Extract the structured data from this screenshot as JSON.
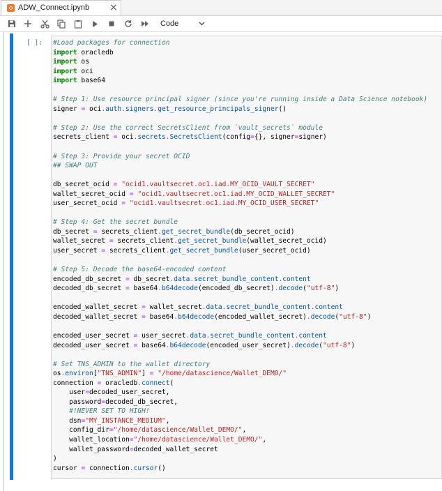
{
  "tab": {
    "title": "ADW_Connect.ipynb",
    "close_label": "×"
  },
  "toolbar": {
    "cell_type": "Code",
    "buttons": [
      "save-icon",
      "add-icon",
      "cut-icon",
      "copy-icon",
      "paste-icon",
      "run-icon",
      "stop-icon",
      "restart-icon",
      "fast-forward-icon"
    ]
  },
  "cell": {
    "prompt": "[ ]:",
    "lines": [
      [
        {
          "t": "cm",
          "v": "#Load packages for connection"
        }
      ],
      [
        {
          "t": "kw",
          "v": "import"
        },
        {
          "t": "var",
          "v": " oracledb"
        }
      ],
      [
        {
          "t": "kw",
          "v": "import"
        },
        {
          "t": "var",
          "v": " os"
        }
      ],
      [
        {
          "t": "kw",
          "v": "import"
        },
        {
          "t": "var",
          "v": " oci"
        }
      ],
      [
        {
          "t": "kw",
          "v": "import"
        },
        {
          "t": "var",
          "v": " base64"
        }
      ],
      [],
      [
        {
          "t": "cm",
          "v": "# Step 1: Use resource principal signer (since you're running inside a Data Science notebook)"
        }
      ],
      [
        {
          "t": "var",
          "v": "signer "
        },
        {
          "t": "op",
          "v": "="
        },
        {
          "t": "var",
          "v": " oci"
        },
        {
          "t": "op",
          "v": "."
        },
        {
          "t": "attr",
          "v": "auth"
        },
        {
          "t": "op",
          "v": "."
        },
        {
          "t": "attr",
          "v": "signers"
        },
        {
          "t": "op",
          "v": "."
        },
        {
          "t": "attr",
          "v": "get_resource_principals_signer"
        },
        {
          "t": "var",
          "v": "()"
        }
      ],
      [],
      [
        {
          "t": "cm",
          "v": "# Step 2: Use the correct SecretsClient from `vault_secrets` module"
        }
      ],
      [
        {
          "t": "var",
          "v": "secrets_client "
        },
        {
          "t": "op",
          "v": "="
        },
        {
          "t": "var",
          "v": " oci"
        },
        {
          "t": "op",
          "v": "."
        },
        {
          "t": "attr",
          "v": "secrets"
        },
        {
          "t": "op",
          "v": "."
        },
        {
          "t": "attr",
          "v": "SecretsClient"
        },
        {
          "t": "var",
          "v": "(config"
        },
        {
          "t": "op",
          "v": "="
        },
        {
          "t": "var",
          "v": "{}, signer"
        },
        {
          "t": "op",
          "v": "="
        },
        {
          "t": "var",
          "v": "signer)"
        }
      ],
      [],
      [
        {
          "t": "cm",
          "v": "# Step 3: Provide your secret OCID"
        }
      ],
      [
        {
          "t": "cm",
          "v": "## SWAP OUT"
        }
      ],
      [],
      [
        {
          "t": "var",
          "v": "db_secret_ocid "
        },
        {
          "t": "op",
          "v": "="
        },
        {
          "t": "var",
          "v": " "
        },
        {
          "t": "st",
          "v": "\"ocid1.vaultsecret.oc1.iad.MY_OCID_VAULT_SECRET\""
        }
      ],
      [
        {
          "t": "var",
          "v": "wallet_secret_ocid "
        },
        {
          "t": "op",
          "v": "="
        },
        {
          "t": "var",
          "v": " "
        },
        {
          "t": "st",
          "v": "\"ocid1.vaultsecret.oc1.iad.MY_OCID_WALLET_SECRET\""
        }
      ],
      [
        {
          "t": "var",
          "v": "user_secret_ocid "
        },
        {
          "t": "op",
          "v": "="
        },
        {
          "t": "var",
          "v": " "
        },
        {
          "t": "st",
          "v": "\"ocid1.vaultsecret.oc1.iad.MY_OCID_USER_SECRET\""
        }
      ],
      [],
      [
        {
          "t": "cm",
          "v": "# Step 4: Get the secret bundle"
        }
      ],
      [
        {
          "t": "var",
          "v": "db_secret "
        },
        {
          "t": "op",
          "v": "="
        },
        {
          "t": "var",
          "v": " secrets_client"
        },
        {
          "t": "op",
          "v": "."
        },
        {
          "t": "attr",
          "v": "get_secret_bundle"
        },
        {
          "t": "var",
          "v": "(db_secret_ocid)"
        }
      ],
      [
        {
          "t": "var",
          "v": "wallet_secret "
        },
        {
          "t": "op",
          "v": "="
        },
        {
          "t": "var",
          "v": " secrets_client"
        },
        {
          "t": "op",
          "v": "."
        },
        {
          "t": "attr",
          "v": "get_secret_bundle"
        },
        {
          "t": "var",
          "v": "(wallet_secret_ocid)"
        }
      ],
      [
        {
          "t": "var",
          "v": "user_secret "
        },
        {
          "t": "op",
          "v": "="
        },
        {
          "t": "var",
          "v": " secrets_client"
        },
        {
          "t": "op",
          "v": "."
        },
        {
          "t": "attr",
          "v": "get_secret_bundle"
        },
        {
          "t": "var",
          "v": "(user_secret_ocid)"
        }
      ],
      [],
      [
        {
          "t": "cm",
          "v": "# Step 5: Decode the base64-encoded content"
        }
      ],
      [
        {
          "t": "var",
          "v": "encoded_db_secret "
        },
        {
          "t": "op",
          "v": "="
        },
        {
          "t": "var",
          "v": " db_secret"
        },
        {
          "t": "op",
          "v": "."
        },
        {
          "t": "attr",
          "v": "data"
        },
        {
          "t": "op",
          "v": "."
        },
        {
          "t": "attr",
          "v": "secret_bundle_content"
        },
        {
          "t": "op",
          "v": "."
        },
        {
          "t": "attr",
          "v": "content"
        }
      ],
      [
        {
          "t": "var",
          "v": "decoded_db_secret "
        },
        {
          "t": "op",
          "v": "="
        },
        {
          "t": "var",
          "v": " base64"
        },
        {
          "t": "op",
          "v": "."
        },
        {
          "t": "attr",
          "v": "b64decode"
        },
        {
          "t": "var",
          "v": "(encoded_db_secret)"
        },
        {
          "t": "op",
          "v": "."
        },
        {
          "t": "attr",
          "v": "decode"
        },
        {
          "t": "var",
          "v": "("
        },
        {
          "t": "st",
          "v": "\"utf-8\""
        },
        {
          "t": "var",
          "v": ")"
        }
      ],
      [],
      [
        {
          "t": "var",
          "v": "encoded_wallet_secret "
        },
        {
          "t": "op",
          "v": "="
        },
        {
          "t": "var",
          "v": " wallet_secret"
        },
        {
          "t": "op",
          "v": "."
        },
        {
          "t": "attr",
          "v": "data"
        },
        {
          "t": "op",
          "v": "."
        },
        {
          "t": "attr",
          "v": "secret_bundle_content"
        },
        {
          "t": "op",
          "v": "."
        },
        {
          "t": "attr",
          "v": "content"
        }
      ],
      [
        {
          "t": "var",
          "v": "decoded_wallet_secret "
        },
        {
          "t": "op",
          "v": "="
        },
        {
          "t": "var",
          "v": " base64"
        },
        {
          "t": "op",
          "v": "."
        },
        {
          "t": "attr",
          "v": "b64decode"
        },
        {
          "t": "var",
          "v": "(encoded_wallet_secret)"
        },
        {
          "t": "op",
          "v": "."
        },
        {
          "t": "attr",
          "v": "decode"
        },
        {
          "t": "var",
          "v": "("
        },
        {
          "t": "st",
          "v": "\"utf-8\""
        },
        {
          "t": "var",
          "v": ")"
        }
      ],
      [],
      [
        {
          "t": "var",
          "v": "encoded_user_secret "
        },
        {
          "t": "op",
          "v": "="
        },
        {
          "t": "var",
          "v": " user_secret"
        },
        {
          "t": "op",
          "v": "."
        },
        {
          "t": "attr",
          "v": "data"
        },
        {
          "t": "op",
          "v": "."
        },
        {
          "t": "attr",
          "v": "secret_bundle_content"
        },
        {
          "t": "op",
          "v": "."
        },
        {
          "t": "attr",
          "v": "content"
        }
      ],
      [
        {
          "t": "var",
          "v": "decoded_user_secret "
        },
        {
          "t": "op",
          "v": "="
        },
        {
          "t": "var",
          "v": " base64"
        },
        {
          "t": "op",
          "v": "."
        },
        {
          "t": "attr",
          "v": "b64decode"
        },
        {
          "t": "var",
          "v": "(encoded_user_secret)"
        },
        {
          "t": "op",
          "v": "."
        },
        {
          "t": "attr",
          "v": "decode"
        },
        {
          "t": "var",
          "v": "("
        },
        {
          "t": "st",
          "v": "\"utf-8\""
        },
        {
          "t": "var",
          "v": ")"
        }
      ],
      [],
      [
        {
          "t": "cm",
          "v": "# Set TNS_ADMIN to the wallet directory"
        }
      ],
      [
        {
          "t": "var",
          "v": "os"
        },
        {
          "t": "op",
          "v": "."
        },
        {
          "t": "attr",
          "v": "environ"
        },
        {
          "t": "var",
          "v": "["
        },
        {
          "t": "st",
          "v": "\"TNS_ADMIN\""
        },
        {
          "t": "var",
          "v": "] "
        },
        {
          "t": "op",
          "v": "="
        },
        {
          "t": "var",
          "v": " "
        },
        {
          "t": "st",
          "v": "\"/home/datascience/Wallet_DEMO/\""
        }
      ],
      [
        {
          "t": "var",
          "v": "connection "
        },
        {
          "t": "op",
          "v": "="
        },
        {
          "t": "var",
          "v": " oracledb"
        },
        {
          "t": "op",
          "v": "."
        },
        {
          "t": "attr",
          "v": "connect"
        },
        {
          "t": "var",
          "v": "("
        }
      ],
      [
        {
          "t": "var",
          "v": "    user"
        },
        {
          "t": "op",
          "v": "="
        },
        {
          "t": "var",
          "v": "decoded_user_secret,"
        }
      ],
      [
        {
          "t": "var",
          "v": "    password"
        },
        {
          "t": "op",
          "v": "="
        },
        {
          "t": "var",
          "v": "decoded_db_secret,"
        }
      ],
      [
        {
          "t": "var",
          "v": "    "
        },
        {
          "t": "cm",
          "v": "#!NEVER SET TO HIGH!"
        }
      ],
      [
        {
          "t": "var",
          "v": "    dsn"
        },
        {
          "t": "op",
          "v": "="
        },
        {
          "t": "st",
          "v": "\"MY_INSTANCE_MEDIUM\""
        },
        {
          "t": "var",
          "v": ","
        }
      ],
      [
        {
          "t": "var",
          "v": "    config_dir"
        },
        {
          "t": "op",
          "v": "="
        },
        {
          "t": "st",
          "v": "\"/home/datascience/Wallet_DEMO/\""
        },
        {
          "t": "var",
          "v": ","
        }
      ],
      [
        {
          "t": "var",
          "v": "    wallet_location"
        },
        {
          "t": "op",
          "v": "="
        },
        {
          "t": "st",
          "v": "\"/home/datascience/Wallet_DEMO/\""
        },
        {
          "t": "var",
          "v": ","
        }
      ],
      [
        {
          "t": "var",
          "v": "    wallet_password"
        },
        {
          "t": "op",
          "v": "="
        },
        {
          "t": "var",
          "v": "decoded_wallet_secret"
        }
      ],
      [
        {
          "t": "var",
          "v": ")"
        }
      ],
      [
        {
          "t": "var",
          "v": "cursor "
        },
        {
          "t": "op",
          "v": "="
        },
        {
          "t": "var",
          "v": " connection"
        },
        {
          "t": "op",
          "v": "."
        },
        {
          "t": "attr",
          "v": "cursor"
        },
        {
          "t": "var",
          "v": "()"
        }
      ]
    ]
  }
}
